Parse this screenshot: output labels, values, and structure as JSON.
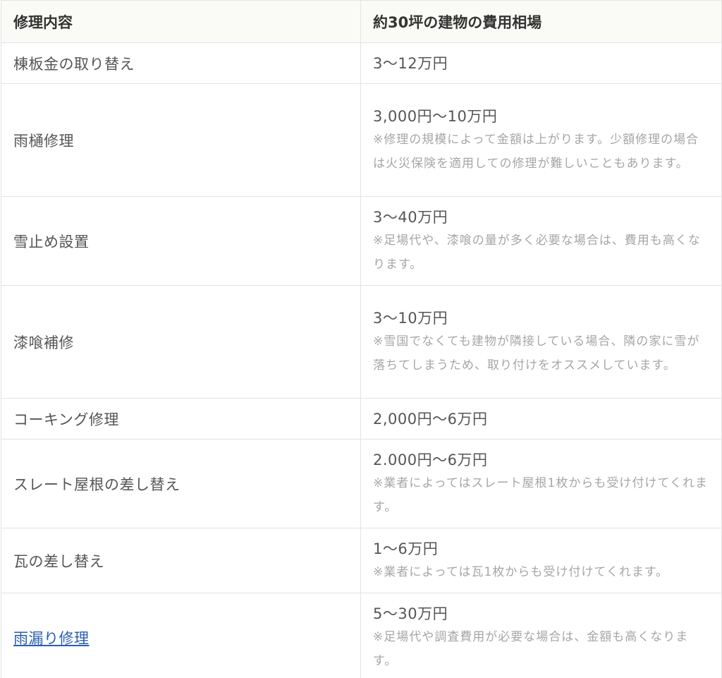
{
  "table": {
    "headers": {
      "item": "修理内容",
      "cost": "約30坪の建物の費用相場"
    },
    "rows": [
      {
        "item": "棟板金の取り替え",
        "price": "3〜12万円",
        "note": ""
      },
      {
        "item": "雨樋修理",
        "price": "3,000円〜10万円",
        "note": "※修理の規模によって金額は上がります。少額修理の場合は火災保険を適用しての修理が難しいこともあります。"
      },
      {
        "item": "雪止め設置",
        "price": "3〜40万円",
        "note": "※足場代や、漆喰の量が多く必要な場合は、費用も高くなります。"
      },
      {
        "item": "漆喰補修",
        "price": "3〜10万円",
        "note": "※雪国でなくても建物が隣接している場合、隣の家に雪が落ちてしまうため、取り付けをオススメしています。"
      },
      {
        "item": "コーキング修理",
        "price": "2,000円〜6万円",
        "note": ""
      },
      {
        "item": "スレート屋根の差し替え",
        "price": "2.000円〜6万円",
        "note": "※業者によってはスレート屋根1枚からも受け付けてくれます。"
      },
      {
        "item": "瓦の差し替え",
        "price": "1〜6万円",
        "note": "※業者によっては瓦1枚からも受け付けてくれます。"
      },
      {
        "item": "雨漏り修理",
        "price": "5〜30万円",
        "note": "※足場代や調査費用が必要な場合は、金額も高くなります。"
      }
    ]
  }
}
